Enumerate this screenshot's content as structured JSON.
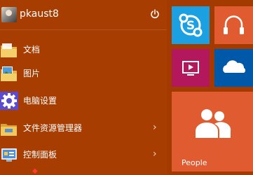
{
  "user": {
    "name": "pkaust8"
  },
  "menu": {
    "items": [
      {
        "label": "文档",
        "icon": "folder-icon"
      },
      {
        "label": "图片",
        "icon": "pictures-folder-icon"
      },
      {
        "label": "电脑设置",
        "icon": "gear-icon"
      },
      {
        "label": "文件资源管理器",
        "icon": "file-explorer-icon",
        "has_submenu": true
      },
      {
        "label": "控制面板",
        "icon": "control-panel-icon",
        "has_submenu": true
      }
    ]
  },
  "tiles": {
    "skype": {
      "icon": "skype-icon",
      "color": "#1ba1e2"
    },
    "music": {
      "icon": "headphones-icon",
      "color": "#e15b30"
    },
    "video": {
      "icon": "video-icon",
      "color": "#b3175c"
    },
    "onedrive": {
      "icon": "cloud-icon",
      "color": "#0059a8"
    },
    "people": {
      "label": "People",
      "icon": "people-icon",
      "color": "#e15b30"
    }
  },
  "colors": {
    "menu_background": "#a83d02",
    "accent": "#ff3b30"
  }
}
